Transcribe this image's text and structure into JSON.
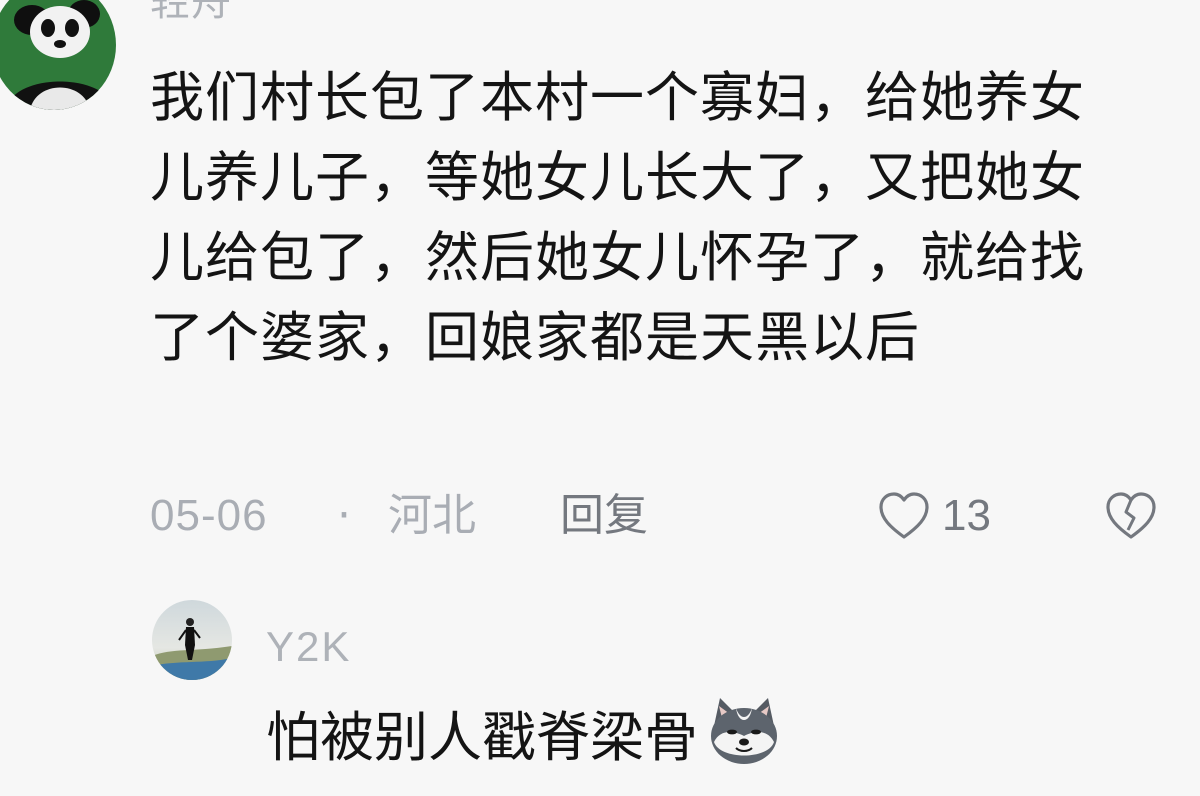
{
  "comments": [
    {
      "username": "轻舟",
      "avatar_icon": "panda-avatar",
      "content": "我们村长包了本村一个寡妇，给她养女儿养儿子，等她女儿长大了，又把她女儿给包了，然后她女儿怀孕了，就给找了个婆家，回娘家都是天黑以后",
      "date": "05-06",
      "separator": "·",
      "location": "河北",
      "reply_label": "回复",
      "like_count": "13",
      "like_icon": "heart-outline-icon",
      "dislike_icon": "broken-heart-icon"
    },
    {
      "username": "Y2K",
      "avatar_icon": "person-photo-avatar",
      "content": "怕被别人戳脊梁骨",
      "emoji_icon": "husky-dog-emoji"
    }
  ],
  "colors": {
    "background": "#f7f7f7",
    "text": "#141414",
    "muted": "#a9adb4",
    "action": "#74787f"
  }
}
